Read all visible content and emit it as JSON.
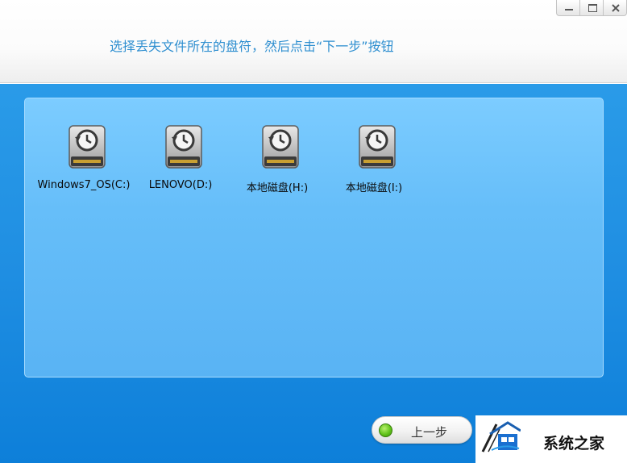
{
  "header": {
    "instruction": "选择丢失文件所在的盘符，然后点击“下一步”按钮"
  },
  "window_controls": [
    {
      "name": "minimize-button",
      "icon": "minimize-icon"
    },
    {
      "name": "maximize-button",
      "icon": "maximize-icon"
    },
    {
      "name": "close-button",
      "icon": "close-icon"
    }
  ],
  "drives": [
    {
      "label": "Windows7_OS(C:)",
      "icon": "hard-drive-restore-icon"
    },
    {
      "label": "LENOVO(D:)",
      "icon": "hard-drive-restore-icon"
    },
    {
      "label": "本地磁盘(H:)",
      "icon": "hard-drive-restore-icon"
    },
    {
      "label": "本地磁盘(I:)",
      "icon": "hard-drive-restore-icon"
    }
  ],
  "footer": {
    "prev_label": "上一步"
  },
  "watermark": {
    "text": "系统之家"
  },
  "colors": {
    "accent": "#2f8fd0",
    "background_blue": "#1f8ee2",
    "panel_blue": "#66bef9",
    "status_green": "#62c41b"
  }
}
